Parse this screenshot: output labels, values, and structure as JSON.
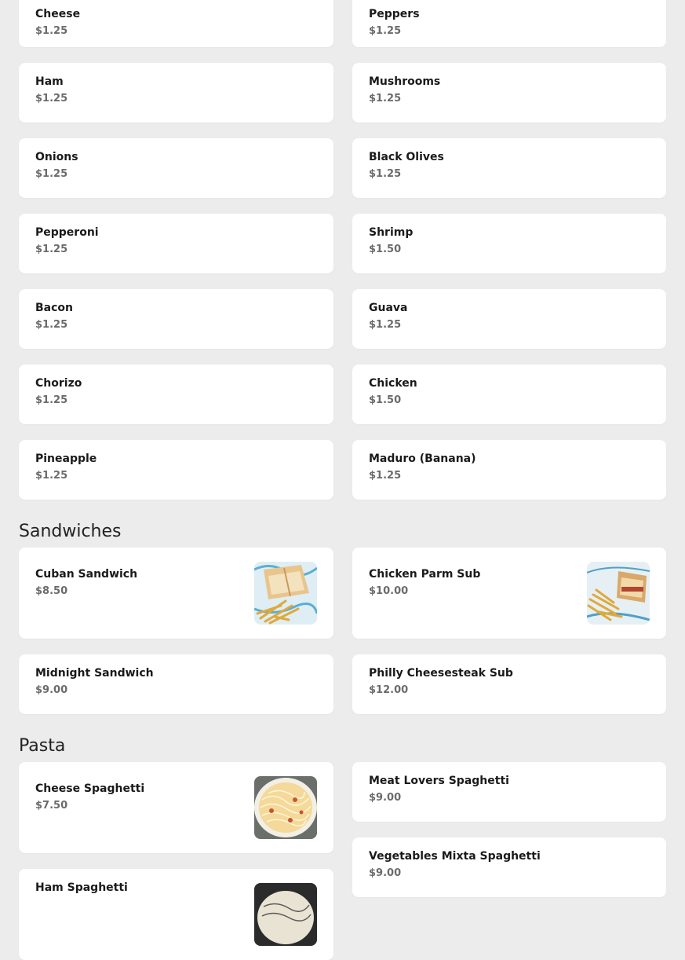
{
  "toppings": [
    {
      "name": "Cheese",
      "price": "$1.25"
    },
    {
      "name": "Peppers",
      "price": "$1.25"
    },
    {
      "name": "Ham",
      "price": "$1.25"
    },
    {
      "name": "Mushrooms",
      "price": "$1.25"
    },
    {
      "name": "Onions",
      "price": "$1.25"
    },
    {
      "name": "Black Olives",
      "price": "$1.25"
    },
    {
      "name": "Pepperoni",
      "price": "$1.25"
    },
    {
      "name": "Shrimp",
      "price": "$1.50"
    },
    {
      "name": "Bacon",
      "price": "$1.25"
    },
    {
      "name": "Guava",
      "price": "$1.25"
    },
    {
      "name": "Chorizo",
      "price": "$1.25"
    },
    {
      "name": "Chicken",
      "price": "$1.50"
    },
    {
      "name": "Pineapple",
      "price": "$1.25"
    },
    {
      "name": "Maduro (Banana)",
      "price": "$1.25"
    }
  ],
  "sandwiches": {
    "title": "Sandwiches",
    "items": [
      {
        "name": "Cuban Sandwich",
        "price": "$8.50",
        "image": "sandwich-fries-photo"
      },
      {
        "name": "Chicken Parm Sub",
        "price": "$10.00",
        "image": "sandwich-fries-photo"
      },
      {
        "name": "Midnight Sandwich",
        "price": "$9.00"
      },
      {
        "name": "Philly Cheesesteak Sub",
        "price": "$12.00"
      }
    ]
  },
  "pasta": {
    "title": "Pasta",
    "items": [
      {
        "name": "Cheese Spaghetti",
        "price": "$7.50",
        "image": "spaghetti-photo"
      },
      {
        "name": "Meat Lovers Spaghetti",
        "price": "$9.00"
      },
      {
        "name": "Vegetables Mixta Spaghetti",
        "price": "$9.00"
      },
      {
        "name": "Ham Spaghetti",
        "price": "",
        "image": "spaghetti-photo"
      }
    ]
  }
}
